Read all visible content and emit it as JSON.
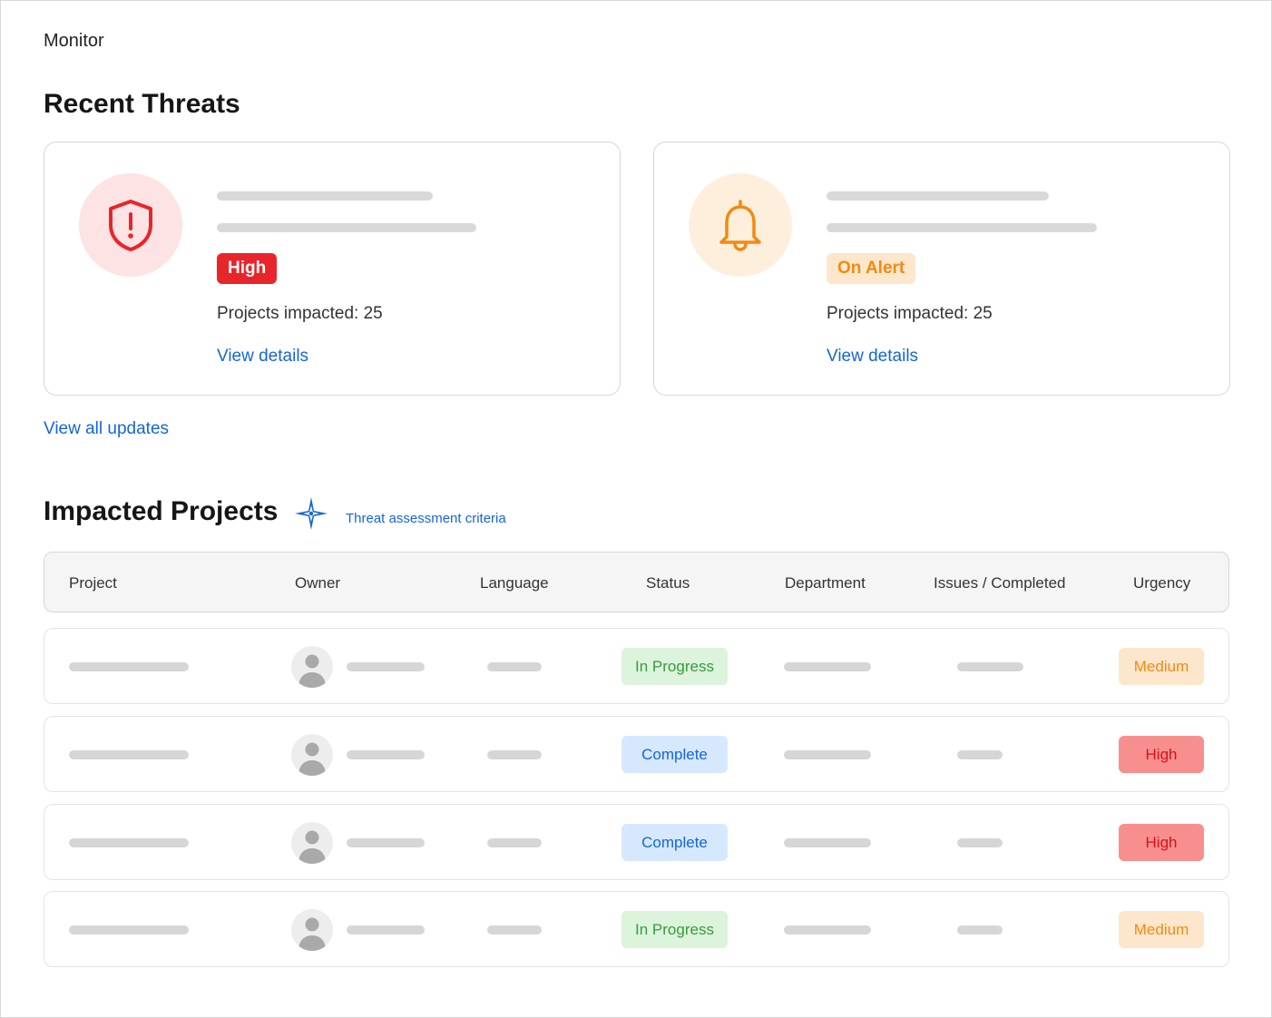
{
  "breadcrumb": "Monitor",
  "recent_threats": {
    "title": "Recent Threats",
    "cards": [
      {
        "icon": "shield-alert-icon",
        "badge": "High",
        "impact": "Projects impacted: 25",
        "link": "View details"
      },
      {
        "icon": "bell-icon",
        "badge": "On Alert",
        "impact": "Projects impacted: 25",
        "link": "View details"
      }
    ],
    "view_all": "View all updates"
  },
  "impacted_projects": {
    "title": "Impacted Projects",
    "criteria_link": "Threat assessment criteria",
    "columns": [
      "Project",
      "Owner",
      "Language",
      "Status",
      "Department",
      "Issues / Completed",
      "Urgency"
    ],
    "rows": [
      {
        "status": "In Progress",
        "urgency": "Medium"
      },
      {
        "status": "Complete",
        "urgency": "High"
      },
      {
        "status": "Complete",
        "urgency": "High"
      },
      {
        "status": "In Progress",
        "urgency": "Medium"
      }
    ]
  },
  "colors": {
    "link": "#1565d8",
    "high": "#e8252b",
    "alert": "#f28a12",
    "in_progress_bg": "#dcf3dc",
    "in_progress_text": "#3a9a3a",
    "complete_bg": "#d6e8fd",
    "complete_text": "#1565d8",
    "medium_bg": "#fde7cc",
    "medium_text": "#f28a12",
    "high_bg": "#f88f8f",
    "high_text": "#d4121a"
  }
}
